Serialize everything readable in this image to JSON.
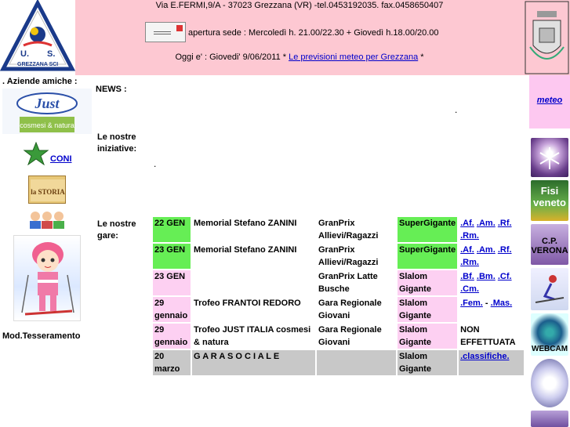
{
  "header": {
    "address": "Via E.FERMI,9/A - 37023 Grezzana (VR) -tel.0453192035. fax.0458650407",
    "hours": "apertura sede : Mercoledì h. 21.00/22.30 + Giovedì h.18.00/20.00",
    "today_prefix": "Oggi e' : Giovedi' 9/06/2011 * ",
    "weather_link": "Le previsioni meteo per Grezzana",
    "today_suffix": " *",
    "logo_letters": "U.S. GREZZANA SCI"
  },
  "left": {
    "title": ". Aziende amiche :",
    "just_logo_word": "Just",
    "just_logo_sub": "cosmesi & natura",
    "coni_link": "CONI",
    "storia_label": "la STORIA",
    "mod_tesseramento": "Mod.Tesseramento"
  },
  "right": {
    "meteo_link": "meteo",
    "fisi2_text": "Fisi veneto",
    "fisi3_text": "C.P. VERONA",
    "webcam_text": "WEBCAM"
  },
  "main": {
    "news_label": "NEWS :",
    "news_dot": ".",
    "iniziative_label": "Le nostre iniziative:",
    "iniziative_dot": ".",
    "gare_label": "Le nostre gare:"
  },
  "races": [
    {
      "style": "green",
      "date": "22 GEN",
      "name": "Memorial Stefano ZANINI",
      "category": "GranPrix Allievi/Ragazzi",
      "discipline": "SuperGigante",
      "links": [
        ".Af.",
        ".Am.",
        ".Rf.",
        ".Rm."
      ]
    },
    {
      "style": "green",
      "date": "23 GEN",
      "name": "Memorial Stefano ZANINI",
      "category": "GranPrix Allievi/Ragazzi",
      "discipline": "SuperGigante",
      "links": [
        ".Af.",
        ".Am.",
        ".Rf.",
        ".Rm."
      ]
    },
    {
      "style": "pink",
      "date": "23 GEN",
      "name": "",
      "category": "GranPrix Latte Busche",
      "discipline": "Slalom Gigante",
      "links": [
        ".Bf.",
        ".Bm.",
        ".Cf.",
        ".Cm."
      ]
    },
    {
      "style": "pink",
      "date": "29 gennaio",
      "name": "Trofeo FRANTOI REDORO",
      "category": "Gara Regionale Giovani",
      "discipline": "Slalom Gigante",
      "links": [
        ".Fem.",
        ".Mas."
      ],
      "link_sep": " - "
    },
    {
      "style": "pink",
      "date": "29 gennaio",
      "name": "Trofeo JUST ITALIA cosmesi & natura",
      "category": "Gara Regionale Giovani",
      "discipline": "Slalom Gigante",
      "note": "NON EFFETTUATA"
    },
    {
      "style": "social",
      "date": "20 marzo",
      "name": "G A R A S O C I A L E",
      "category": "",
      "discipline": "Slalom Gigante",
      "links": [
        ".classifiche."
      ]
    }
  ]
}
